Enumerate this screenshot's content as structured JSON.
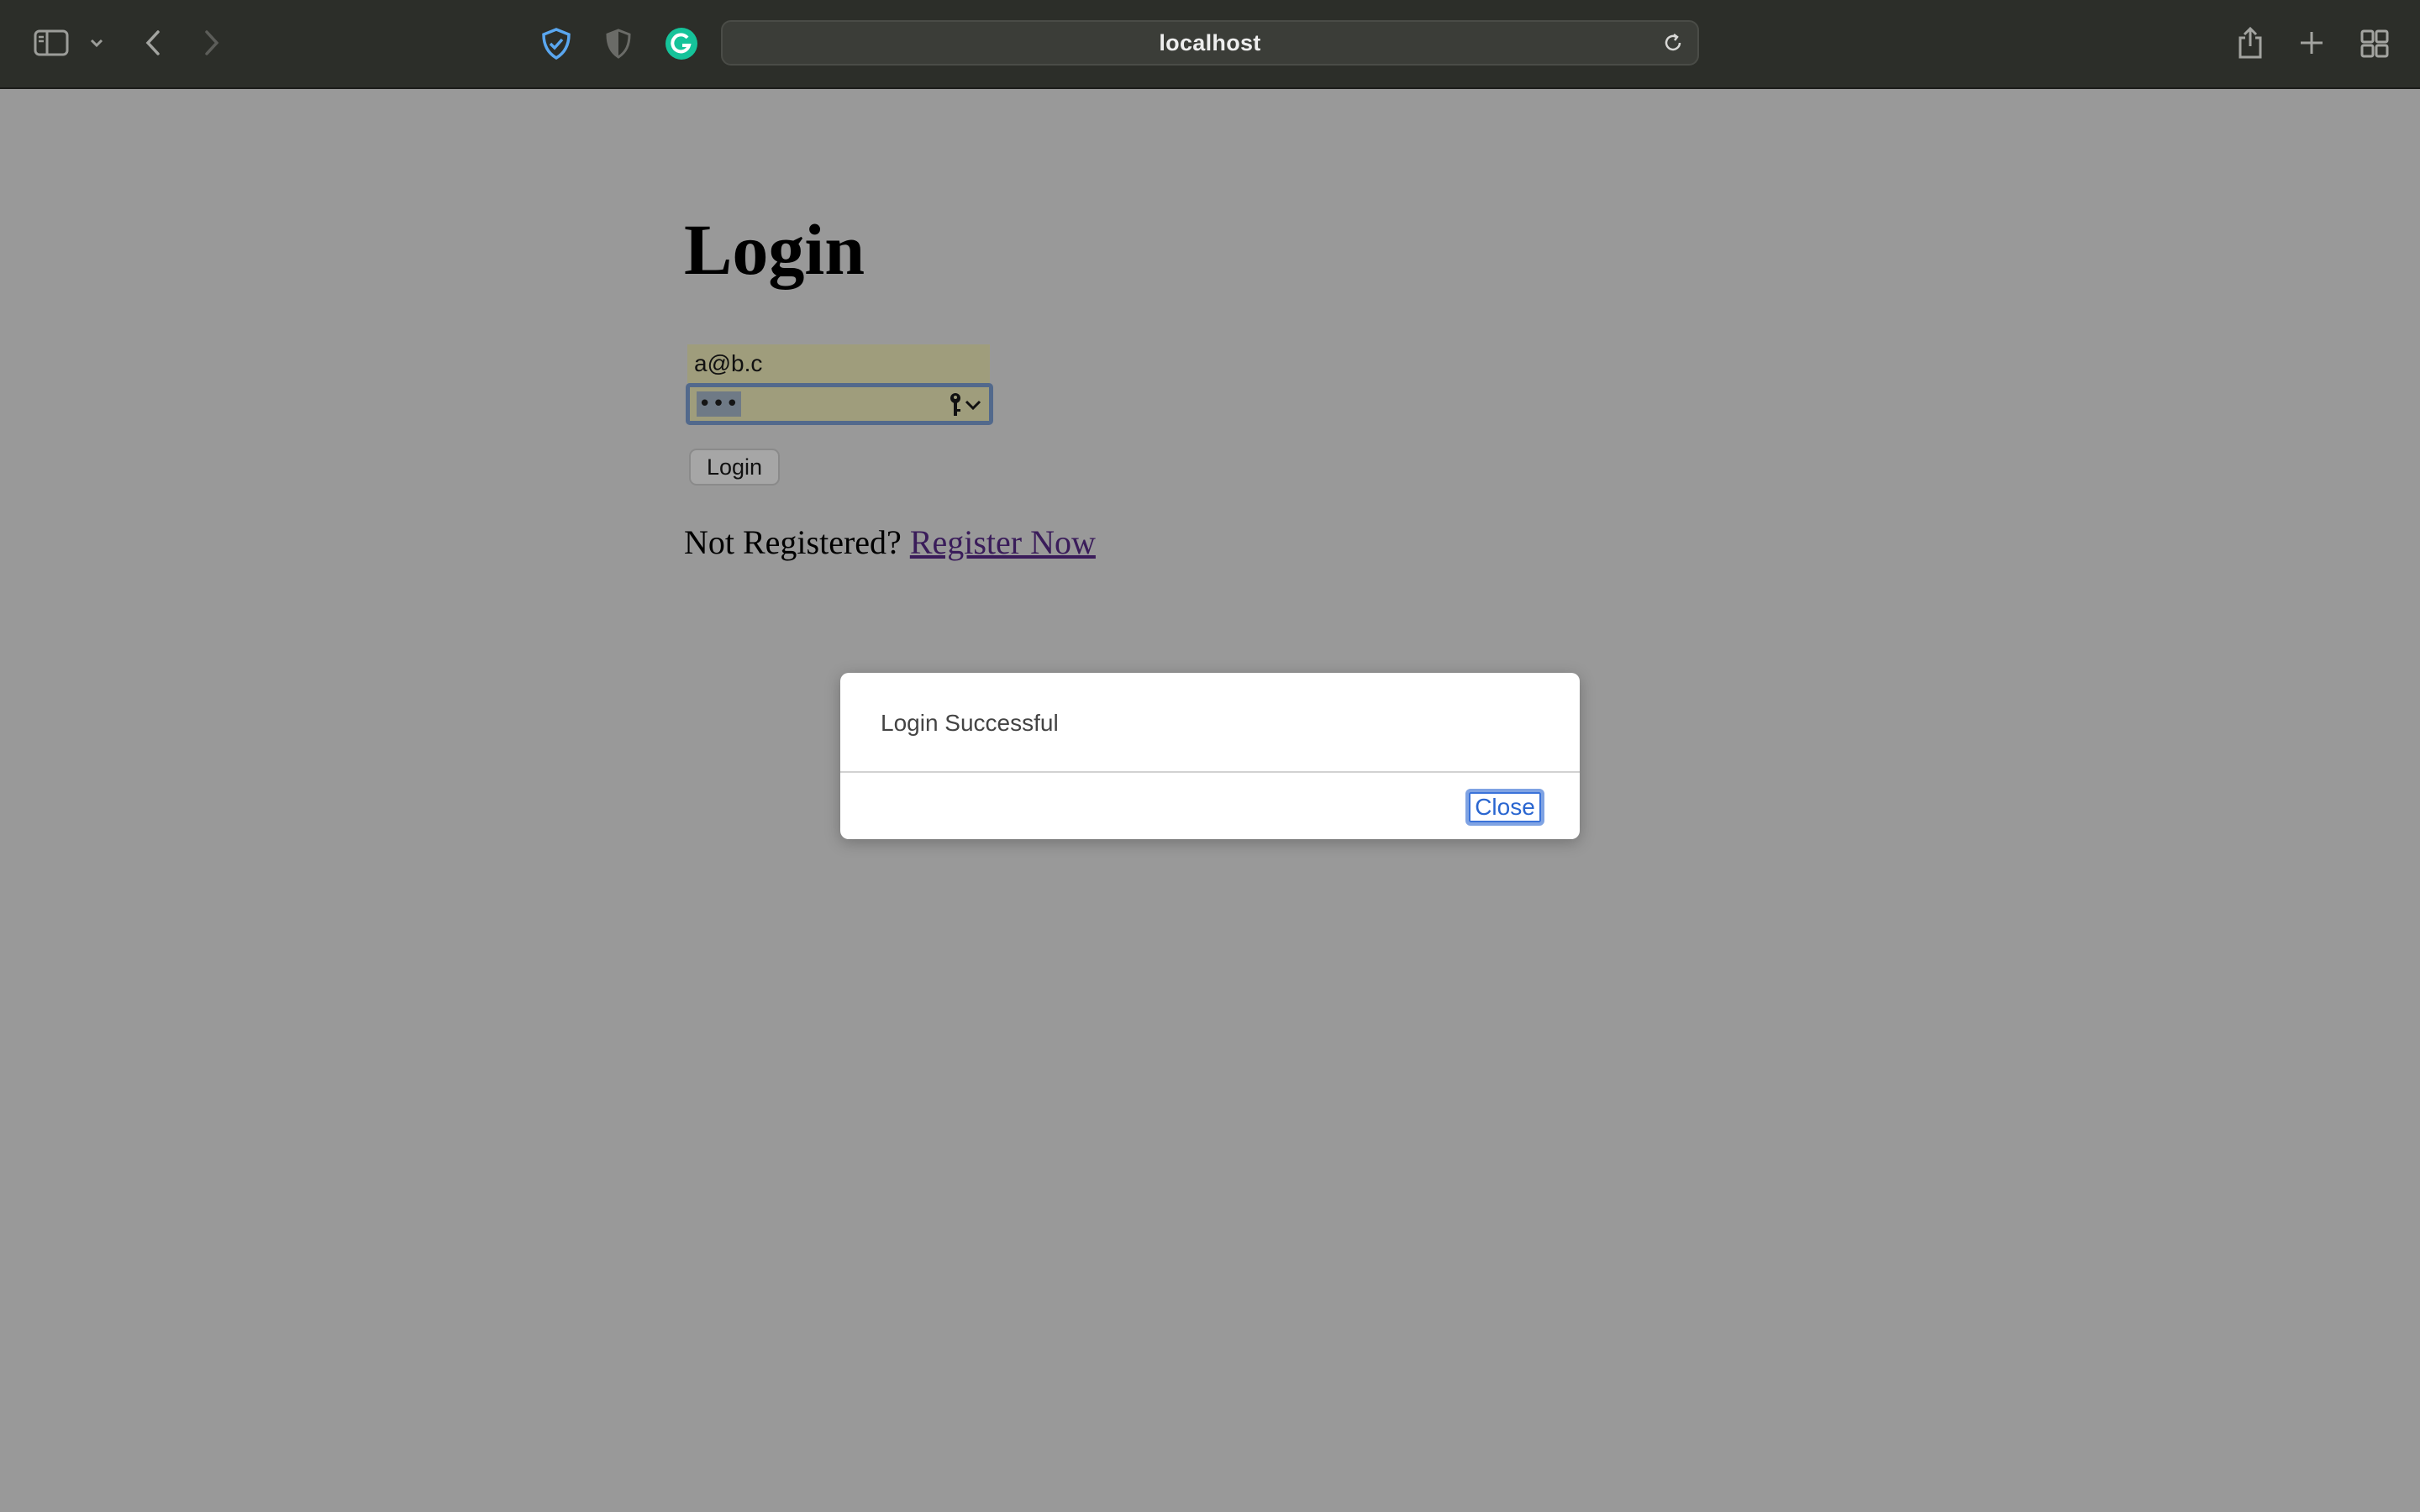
{
  "browser": {
    "address": "localhost",
    "icons": [
      "sidebar-icon",
      "chevron-down-icon",
      "back-arrow-icon",
      "forward-arrow-icon",
      "shield-check-icon",
      "privacy-shield-icon",
      "grammarly-icon",
      "reload-icon",
      "share-icon",
      "new-tab-icon",
      "tab-overview-icon"
    ]
  },
  "page": {
    "heading": "Login",
    "email_value": "a@b.c",
    "password_value": "•••",
    "login_button": "Login",
    "register_prompt": "Not Registered?",
    "register_link": "Register Now"
  },
  "dialog": {
    "message": "Login Successful",
    "close_label": "Close"
  },
  "colors": {
    "page_overlay": "#999999",
    "toolbar": "#2c2e29",
    "autofill_field": "#9f9d7c",
    "link": "#3a1c5a",
    "dialog_button": "#2a66d0"
  }
}
